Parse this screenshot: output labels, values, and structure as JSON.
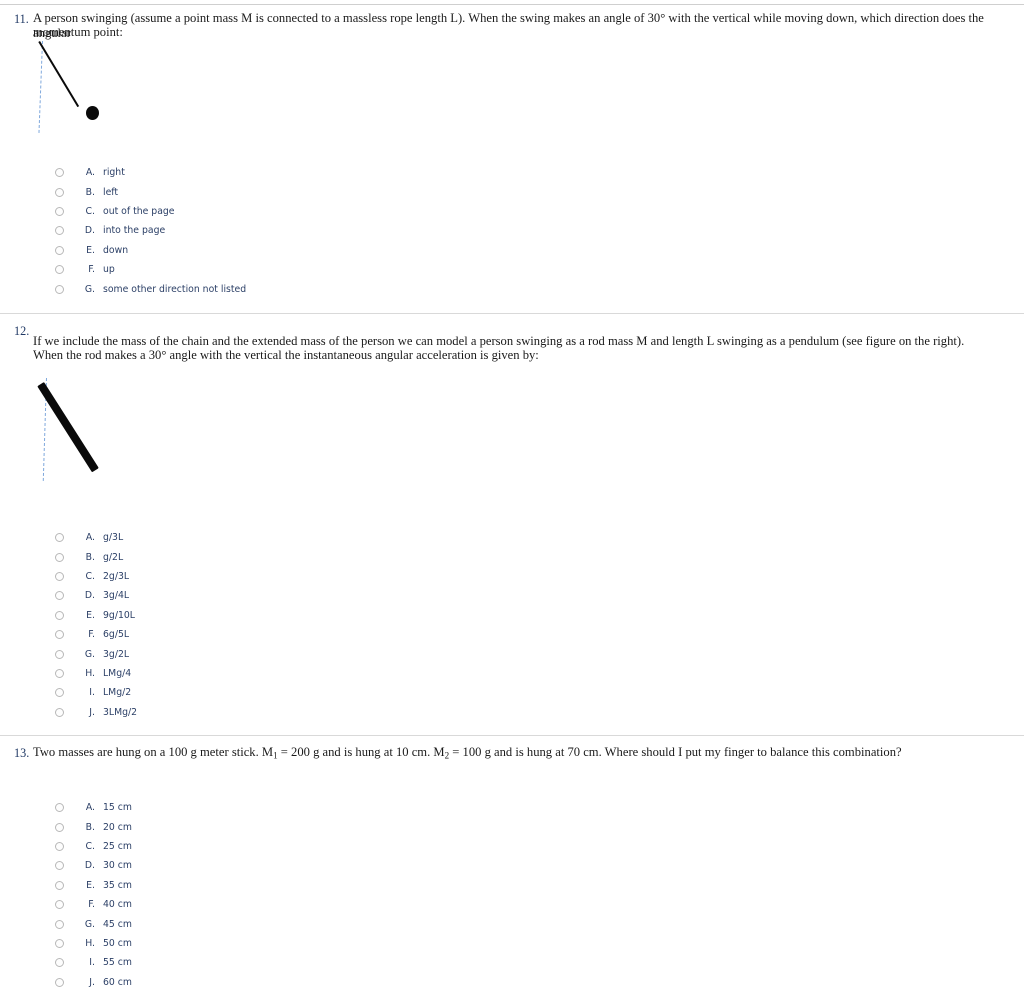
{
  "page": {
    "background": "#ffffff",
    "question_number_color": "#1f3864",
    "option_text_color": "#2b3f66",
    "divider_color": "#d9d9d9"
  },
  "questions": [
    {
      "number": "11.",
      "text_line1": "A person swinging (assume a point mass M is connected to a massless rope length L). When the swing makes an angle of 30° with the vertical while moving down, which direction does the angular",
      "text_line2": "momentum point:",
      "diagram": {
        "name": "point-mass-pendulum-diagram",
        "vertical_reference": "dashed blue vertical line",
        "rope": "black line at 30 degrees from vertical",
        "bob": "filled black circle point mass M"
      },
      "options": [
        {
          "letter": "A.",
          "label": "right"
        },
        {
          "letter": "B.",
          "label": "left"
        },
        {
          "letter": "C.",
          "label": "out of the page"
        },
        {
          "letter": "D.",
          "label": "into the page"
        },
        {
          "letter": "E.",
          "label": "down"
        },
        {
          "letter": "F.",
          "label": "up"
        },
        {
          "letter": "G.",
          "label": "some other direction not listed"
        }
      ]
    },
    {
      "number": "12.",
      "text_line1": "If we include the mass of the chain and the extended mass of the person we can model a person swinging as a rod mass M and length L swinging as a pendulum (see figure on the right).",
      "text_line2": "When the rod makes a 30° angle with the vertical the instantaneous angular acceleration is given by:",
      "diagram": {
        "name": "rod-pendulum-diagram",
        "vertical_reference": "dashed blue vertical line",
        "rod": "thick black rod at 30 degrees from vertical"
      },
      "options": [
        {
          "letter": "A.",
          "label": "g/3L"
        },
        {
          "letter": "B.",
          "label": "g/2L"
        },
        {
          "letter": "C.",
          "label": "2g/3L"
        },
        {
          "letter": "D.",
          "label": "3g/4L"
        },
        {
          "letter": "E.",
          "label": "9g/10L"
        },
        {
          "letter": "F.",
          "label": "6g/5L"
        },
        {
          "letter": "G.",
          "label": "3g/2L"
        },
        {
          "letter": "H.",
          "label": "LMg/4"
        },
        {
          "letter": "I.",
          "label": "LMg/2"
        },
        {
          "letter": "J.",
          "label": "3LMg/2"
        }
      ]
    },
    {
      "number": "13.",
      "text_parts": {
        "a": "Two masses are hung on a 100 g meter stick.  M",
        "sub1": "1",
        "b": " = 200 g and is hung at 10 cm. M",
        "sub2": "2",
        "c": " = 100 g and is hung at 70 cm. Where should I put my finger to balance this combination?"
      },
      "options": [
        {
          "letter": "A.",
          "label": "15 cm"
        },
        {
          "letter": "B.",
          "label": "20 cm"
        },
        {
          "letter": "C.",
          "label": "25 cm"
        },
        {
          "letter": "D.",
          "label": "30 cm"
        },
        {
          "letter": "E.",
          "label": "35 cm"
        },
        {
          "letter": "F.",
          "label": "40 cm"
        },
        {
          "letter": "G.",
          "label": "45 cm"
        },
        {
          "letter": "H.",
          "label": "50 cm"
        },
        {
          "letter": "I.",
          "label": "55 cm"
        },
        {
          "letter": "J.",
          "label": "60 cm"
        }
      ]
    }
  ]
}
